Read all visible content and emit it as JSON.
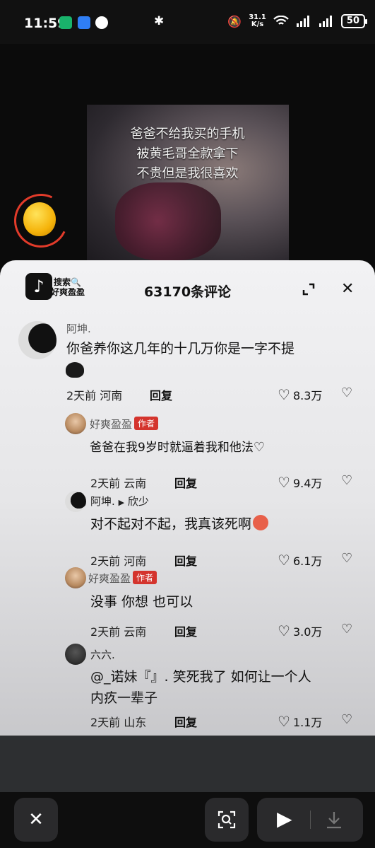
{
  "status_bar": {
    "time": "11:59",
    "net_speed_value": "31.1",
    "net_speed_unit": "K/s",
    "battery": "50"
  },
  "video": {
    "caption_lines": [
      "爸爸不给我买的手机",
      "被黄毛哥全款拿下",
      "不贵但是我很喜欢"
    ]
  },
  "panel": {
    "logo_tag_line1": "搜索",
    "logo_tag_line2": "好爽盈盈",
    "comment_count": "63170条评论"
  },
  "comments": [
    {
      "name": "阿坤.",
      "text": "你爸养你这几年的十几万你是一字不提",
      "time_location": "2天前 河南",
      "reply": "回复",
      "likes": "8.3万"
    },
    {
      "name": "好爽盈盈",
      "badge": "作者",
      "text": "爸爸在我9岁时就逼着我和他法",
      "time_location": "2天前 云南",
      "reply": "回复",
      "likes": "9.4万"
    },
    {
      "name": "阿坤.",
      "reply_to": "欣少",
      "text": "对不起对不起，我真该死啊",
      "time_location": "2天前 河南",
      "reply": "回复",
      "likes": "6.1万"
    },
    {
      "name": "好爽盈盈",
      "badge": "作者",
      "text": "没事 你想 也可以",
      "time_location": "2天前 云南",
      "reply": "回复",
      "likes": "3.0万"
    },
    {
      "name": "六六.",
      "text_line1": "@_诺妹『』. 笑死我了 如何让一个人",
      "text_line2": "内疚一辈子",
      "time_location": "2天前 山东",
      "reply": "回复",
      "likes": "1.1万"
    }
  ],
  "colors": {
    "author_badge": "#d4342d",
    "panel_bg": "#f2f2f4",
    "toolbar_bg": "#0e0e0e"
  }
}
